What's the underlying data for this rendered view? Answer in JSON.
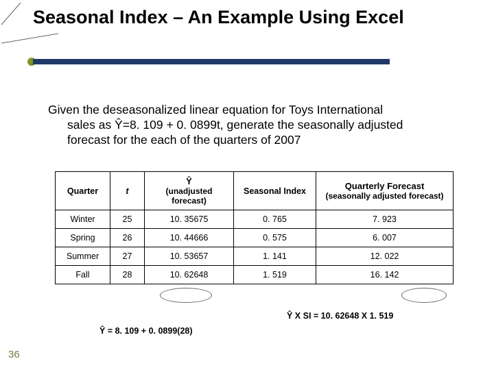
{
  "title": "Seasonal Index – An Example Using Excel",
  "body": {
    "line1": "Given the deseasonalized linear equation for Toys International",
    "line2": "sales as Ŷ=8. 109 + 0. 0899t, generate the seasonally adjusted",
    "line3": "forecast for the each of the quarters of 2007"
  },
  "headers": {
    "quarter": "Quarter",
    "t": "t",
    "yhat_top": "Ŷ",
    "yhat_sub": "(unadjusted forecast)",
    "si": "Seasonal Index",
    "qf_top": "Quarterly Forecast",
    "qf_sub": "(seasonally adjusted forecast)"
  },
  "rows": [
    {
      "quarter": "Winter",
      "t": "25",
      "yhat": "10. 35675",
      "si": "0. 765",
      "qf": "7. 923"
    },
    {
      "quarter": "Spring",
      "t": "26",
      "yhat": "10. 44666",
      "si": "0. 575",
      "qf": "6. 007"
    },
    {
      "quarter": "Summer",
      "t": "27",
      "yhat": "10. 53657",
      "si": "1. 141",
      "qf": "12. 022"
    },
    {
      "quarter": "Fall",
      "t": "28",
      "yhat": "10. 62648",
      "si": "1. 519",
      "qf": "16. 142"
    }
  ],
  "eq1": "Ŷ = 8. 109 + 0. 0899(28)",
  "eq2": "Ŷ X SI = 10. 62648 X 1. 519",
  "slide_number": "36",
  "chart_data": {
    "type": "table",
    "title": "Seasonal Index – An Example Using Excel",
    "columns": [
      "Quarter",
      "t",
      "Ŷ (unadjusted forecast)",
      "Seasonal Index",
      "Quarterly Forecast (seasonally adjusted forecast)"
    ],
    "rows": [
      [
        "Winter",
        25,
        10.35675,
        0.765,
        7.923
      ],
      [
        "Spring",
        26,
        10.44666,
        0.575,
        6.007
      ],
      [
        "Summer",
        27,
        10.53657,
        1.141,
        12.022
      ],
      [
        "Fall",
        28,
        10.62648,
        1.519,
        16.142
      ]
    ],
    "equation": "Ŷ = 8.109 + 0.0899 t",
    "annotations": [
      "Ŷ = 8.109 + 0.0899(28)",
      "Ŷ × SI = 10.62648 × 1.519"
    ]
  }
}
